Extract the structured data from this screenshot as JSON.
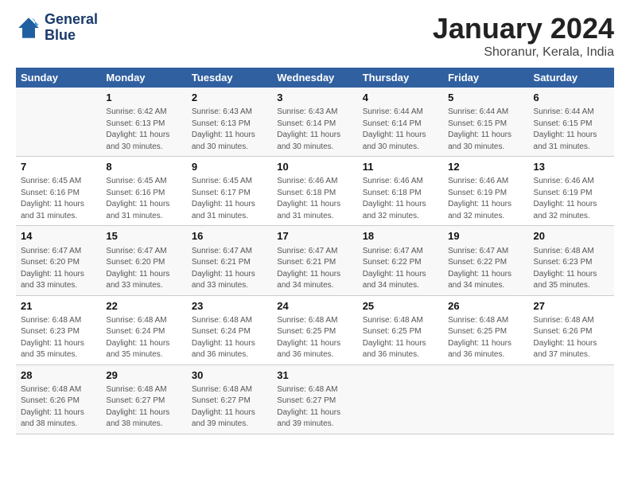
{
  "logo": {
    "line1": "General",
    "line2": "Blue"
  },
  "title": "January 2024",
  "subtitle": "Shoranur, Kerala, India",
  "days_header": [
    "Sunday",
    "Monday",
    "Tuesday",
    "Wednesday",
    "Thursday",
    "Friday",
    "Saturday"
  ],
  "weeks": [
    [
      {
        "day": "",
        "sunrise": "",
        "sunset": "",
        "daylight": ""
      },
      {
        "day": "1",
        "sunrise": "Sunrise: 6:42 AM",
        "sunset": "Sunset: 6:13 PM",
        "daylight": "Daylight: 11 hours and 30 minutes."
      },
      {
        "day": "2",
        "sunrise": "Sunrise: 6:43 AM",
        "sunset": "Sunset: 6:13 PM",
        "daylight": "Daylight: 11 hours and 30 minutes."
      },
      {
        "day": "3",
        "sunrise": "Sunrise: 6:43 AM",
        "sunset": "Sunset: 6:14 PM",
        "daylight": "Daylight: 11 hours and 30 minutes."
      },
      {
        "day": "4",
        "sunrise": "Sunrise: 6:44 AM",
        "sunset": "Sunset: 6:14 PM",
        "daylight": "Daylight: 11 hours and 30 minutes."
      },
      {
        "day": "5",
        "sunrise": "Sunrise: 6:44 AM",
        "sunset": "Sunset: 6:15 PM",
        "daylight": "Daylight: 11 hours and 30 minutes."
      },
      {
        "day": "6",
        "sunrise": "Sunrise: 6:44 AM",
        "sunset": "Sunset: 6:15 PM",
        "daylight": "Daylight: 11 hours and 31 minutes."
      }
    ],
    [
      {
        "day": "7",
        "sunrise": "Sunrise: 6:45 AM",
        "sunset": "Sunset: 6:16 PM",
        "daylight": "Daylight: 11 hours and 31 minutes."
      },
      {
        "day": "8",
        "sunrise": "Sunrise: 6:45 AM",
        "sunset": "Sunset: 6:16 PM",
        "daylight": "Daylight: 11 hours and 31 minutes."
      },
      {
        "day": "9",
        "sunrise": "Sunrise: 6:45 AM",
        "sunset": "Sunset: 6:17 PM",
        "daylight": "Daylight: 11 hours and 31 minutes."
      },
      {
        "day": "10",
        "sunrise": "Sunrise: 6:46 AM",
        "sunset": "Sunset: 6:18 PM",
        "daylight": "Daylight: 11 hours and 31 minutes."
      },
      {
        "day": "11",
        "sunrise": "Sunrise: 6:46 AM",
        "sunset": "Sunset: 6:18 PM",
        "daylight": "Daylight: 11 hours and 32 minutes."
      },
      {
        "day": "12",
        "sunrise": "Sunrise: 6:46 AM",
        "sunset": "Sunset: 6:19 PM",
        "daylight": "Daylight: 11 hours and 32 minutes."
      },
      {
        "day": "13",
        "sunrise": "Sunrise: 6:46 AM",
        "sunset": "Sunset: 6:19 PM",
        "daylight": "Daylight: 11 hours and 32 minutes."
      }
    ],
    [
      {
        "day": "14",
        "sunrise": "Sunrise: 6:47 AM",
        "sunset": "Sunset: 6:20 PM",
        "daylight": "Daylight: 11 hours and 33 minutes."
      },
      {
        "day": "15",
        "sunrise": "Sunrise: 6:47 AM",
        "sunset": "Sunset: 6:20 PM",
        "daylight": "Daylight: 11 hours and 33 minutes."
      },
      {
        "day": "16",
        "sunrise": "Sunrise: 6:47 AM",
        "sunset": "Sunset: 6:21 PM",
        "daylight": "Daylight: 11 hours and 33 minutes."
      },
      {
        "day": "17",
        "sunrise": "Sunrise: 6:47 AM",
        "sunset": "Sunset: 6:21 PM",
        "daylight": "Daylight: 11 hours and 34 minutes."
      },
      {
        "day": "18",
        "sunrise": "Sunrise: 6:47 AM",
        "sunset": "Sunset: 6:22 PM",
        "daylight": "Daylight: 11 hours and 34 minutes."
      },
      {
        "day": "19",
        "sunrise": "Sunrise: 6:47 AM",
        "sunset": "Sunset: 6:22 PM",
        "daylight": "Daylight: 11 hours and 34 minutes."
      },
      {
        "day": "20",
        "sunrise": "Sunrise: 6:48 AM",
        "sunset": "Sunset: 6:23 PM",
        "daylight": "Daylight: 11 hours and 35 minutes."
      }
    ],
    [
      {
        "day": "21",
        "sunrise": "Sunrise: 6:48 AM",
        "sunset": "Sunset: 6:23 PM",
        "daylight": "Daylight: 11 hours and 35 minutes."
      },
      {
        "day": "22",
        "sunrise": "Sunrise: 6:48 AM",
        "sunset": "Sunset: 6:24 PM",
        "daylight": "Daylight: 11 hours and 35 minutes."
      },
      {
        "day": "23",
        "sunrise": "Sunrise: 6:48 AM",
        "sunset": "Sunset: 6:24 PM",
        "daylight": "Daylight: 11 hours and 36 minutes."
      },
      {
        "day": "24",
        "sunrise": "Sunrise: 6:48 AM",
        "sunset": "Sunset: 6:25 PM",
        "daylight": "Daylight: 11 hours and 36 minutes."
      },
      {
        "day": "25",
        "sunrise": "Sunrise: 6:48 AM",
        "sunset": "Sunset: 6:25 PM",
        "daylight": "Daylight: 11 hours and 36 minutes."
      },
      {
        "day": "26",
        "sunrise": "Sunrise: 6:48 AM",
        "sunset": "Sunset: 6:25 PM",
        "daylight": "Daylight: 11 hours and 36 minutes."
      },
      {
        "day": "27",
        "sunrise": "Sunrise: 6:48 AM",
        "sunset": "Sunset: 6:26 PM",
        "daylight": "Daylight: 11 hours and 37 minutes."
      }
    ],
    [
      {
        "day": "28",
        "sunrise": "Sunrise: 6:48 AM",
        "sunset": "Sunset: 6:26 PM",
        "daylight": "Daylight: 11 hours and 38 minutes."
      },
      {
        "day": "29",
        "sunrise": "Sunrise: 6:48 AM",
        "sunset": "Sunset: 6:27 PM",
        "daylight": "Daylight: 11 hours and 38 minutes."
      },
      {
        "day": "30",
        "sunrise": "Sunrise: 6:48 AM",
        "sunset": "Sunset: 6:27 PM",
        "daylight": "Daylight: 11 hours and 39 minutes."
      },
      {
        "day": "31",
        "sunrise": "Sunrise: 6:48 AM",
        "sunset": "Sunset: 6:27 PM",
        "daylight": "Daylight: 11 hours and 39 minutes."
      },
      {
        "day": "",
        "sunrise": "",
        "sunset": "",
        "daylight": ""
      },
      {
        "day": "",
        "sunrise": "",
        "sunset": "",
        "daylight": ""
      },
      {
        "day": "",
        "sunrise": "",
        "sunset": "",
        "daylight": ""
      }
    ]
  ]
}
